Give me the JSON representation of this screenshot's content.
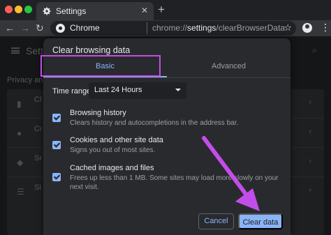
{
  "browser": {
    "tab_title": "Settings",
    "tab_close": "✕",
    "new_tab": "+",
    "omnibox_host": "Chrome",
    "omnibox_url_prefix": "chrome://",
    "omnibox_url_bold": "settings",
    "omnibox_url_suffix": "/clearBrowserData"
  },
  "settings_page": {
    "title": "Settings",
    "section_label": "Privacy and security",
    "rows": [
      {
        "label": "Clear browsing data",
        "icon": "trash-icon"
      },
      {
        "label": "Cookies and other site data",
        "icon": "cookie-icon"
      },
      {
        "label": "Security",
        "icon": "shield-icon"
      },
      {
        "label": "Site settings",
        "icon": "sliders-icon"
      }
    ]
  },
  "dialog": {
    "title": "Clear browsing data",
    "tabs": [
      {
        "label": "Basic",
        "selected": true
      },
      {
        "label": "Advanced",
        "selected": false
      }
    ],
    "time_range_label": "Time range",
    "time_range_value": "Last 24 Hours",
    "options": [
      {
        "title": "Browsing history",
        "description": "Clears history and autocompletions in the address bar.",
        "checked": true
      },
      {
        "title": "Cookies and other site data",
        "description": "Signs you out of most sites.",
        "checked": true
      },
      {
        "title": "Cached images and files",
        "description": "Frees up less than 1 MB. Some sites may load more slowly on your next visit.",
        "checked": true
      }
    ],
    "cancel_label": "Cancel",
    "confirm_label": "Clear data"
  },
  "colors": {
    "accent": "#8ab4f8",
    "annotation": "#c34dea",
    "dialog_bg": "#292a2d",
    "page_bg": "#151618"
  }
}
